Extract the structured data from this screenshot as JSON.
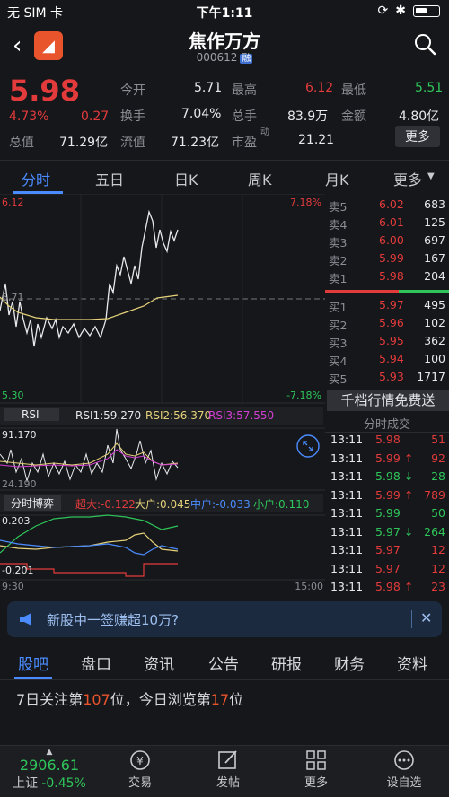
{
  "status_bar": {
    "carrier": "无 SIM 卡",
    "time": "下午1:11"
  },
  "header": {
    "title": "焦作万方",
    "code": "000612",
    "badge": "融"
  },
  "quote": {
    "price": "5.98",
    "change_pct": "4.73%",
    "change": "0.27",
    "total_value_label": "总值",
    "total_value": "71.29亿",
    "labels": [
      "今开",
      "最高",
      "最低",
      "换手",
      "总手",
      "金额",
      "流值",
      "市盈",
      "动"
    ],
    "open": "5.71",
    "high": "6.12",
    "low": "5.51",
    "turnover": "7.04%",
    "volume": "83.9万",
    "amount": "4.80亿",
    "float_value": "71.23亿",
    "pe": "21.21",
    "more": "更多"
  },
  "tabs": [
    "分时",
    "五日",
    "日K",
    "周K",
    "月K",
    "更多"
  ],
  "chart": {
    "y_top": "6.12",
    "y_mid": "5.71",
    "y_bottom": "5.30",
    "pct_top": "7.18%",
    "pct_bottom": "-7.18%",
    "rsi_tab": "RSI",
    "rsi1": "RSI1:59.270",
    "rsi2": "RSI2:56.370",
    "rsi3": "RSI3:57.550",
    "rsi_top": "91.170",
    "rsi_bottom": "24.190",
    "bottom_tab": "分时博弈",
    "big": "超大:-0.122",
    "large": "大户:0.045",
    "mid": "中户:-0.033",
    "small": "小户:0.110",
    "game_top": "0.203",
    "game_bottom": "-0.201",
    "time_start": "9:30",
    "time_end": "15:00"
  },
  "order_book": {
    "sells": [
      {
        "label": "卖5",
        "price": "6.02",
        "vol": "683"
      },
      {
        "label": "卖4",
        "price": "6.01",
        "vol": "125"
      },
      {
        "label": "卖3",
        "price": "6.00",
        "vol": "697"
      },
      {
        "label": "卖2",
        "price": "5.99",
        "vol": "167"
      },
      {
        "label": "卖1",
        "price": "5.98",
        "vol": "204"
      }
    ],
    "buys": [
      {
        "label": "买1",
        "price": "5.97",
        "vol": "495"
      },
      {
        "label": "买2",
        "price": "5.96",
        "vol": "102"
      },
      {
        "label": "买3",
        "price": "5.95",
        "vol": "362"
      },
      {
        "label": "买4",
        "price": "5.94",
        "vol": "100"
      },
      {
        "label": "买5",
        "price": "5.93",
        "vol": "1717"
      }
    ],
    "promo": "千档行情免费送",
    "trades_title": "分时成交",
    "trades": [
      {
        "time": "13:11",
        "price": "5.98",
        "arrow": "",
        "vol": "51",
        "color": "red"
      },
      {
        "time": "13:11",
        "price": "5.99",
        "arrow": "↑",
        "vol": "92",
        "color": "red"
      },
      {
        "time": "13:11",
        "price": "5.98",
        "arrow": "↓",
        "vol": "28",
        "color": "green"
      },
      {
        "time": "13:11",
        "price": "5.99",
        "arrow": "↑",
        "vol": "789",
        "color": "red"
      },
      {
        "time": "13:11",
        "price": "5.99",
        "arrow": "",
        "vol": "50",
        "color": "green"
      },
      {
        "time": "13:11",
        "price": "5.97",
        "arrow": "↓",
        "vol": "264",
        "color": "green"
      },
      {
        "time": "13:11",
        "price": "5.97",
        "arrow": "",
        "vol": "12",
        "color": "red"
      },
      {
        "time": "13:11",
        "price": "5.97",
        "arrow": "",
        "vol": "12",
        "color": "red"
      },
      {
        "time": "13:11",
        "price": "5.98",
        "arrow": "↑",
        "vol": "23",
        "color": "red"
      }
    ]
  },
  "banner": {
    "text": "新股中一签赚超10万?"
  },
  "bottom_tabs": [
    "股吧",
    "盘口",
    "资讯",
    "公告",
    "研报",
    "财务",
    "资料"
  ],
  "rank": {
    "p1": "7日关注第",
    "n1": "107",
    "p2": "位，今日浏览第",
    "n2": "17",
    "p3": "位"
  },
  "toolbar": {
    "index_value": "2906.61",
    "index_name": "上证",
    "index_change": "-0.45%",
    "items": [
      "交易",
      "发帖",
      "更多",
      "设自选"
    ]
  },
  "colors": {
    "up": "#e33b3b",
    "down": "#2fc55a",
    "accent": "#4a8cff",
    "bg": "#16171b"
  }
}
